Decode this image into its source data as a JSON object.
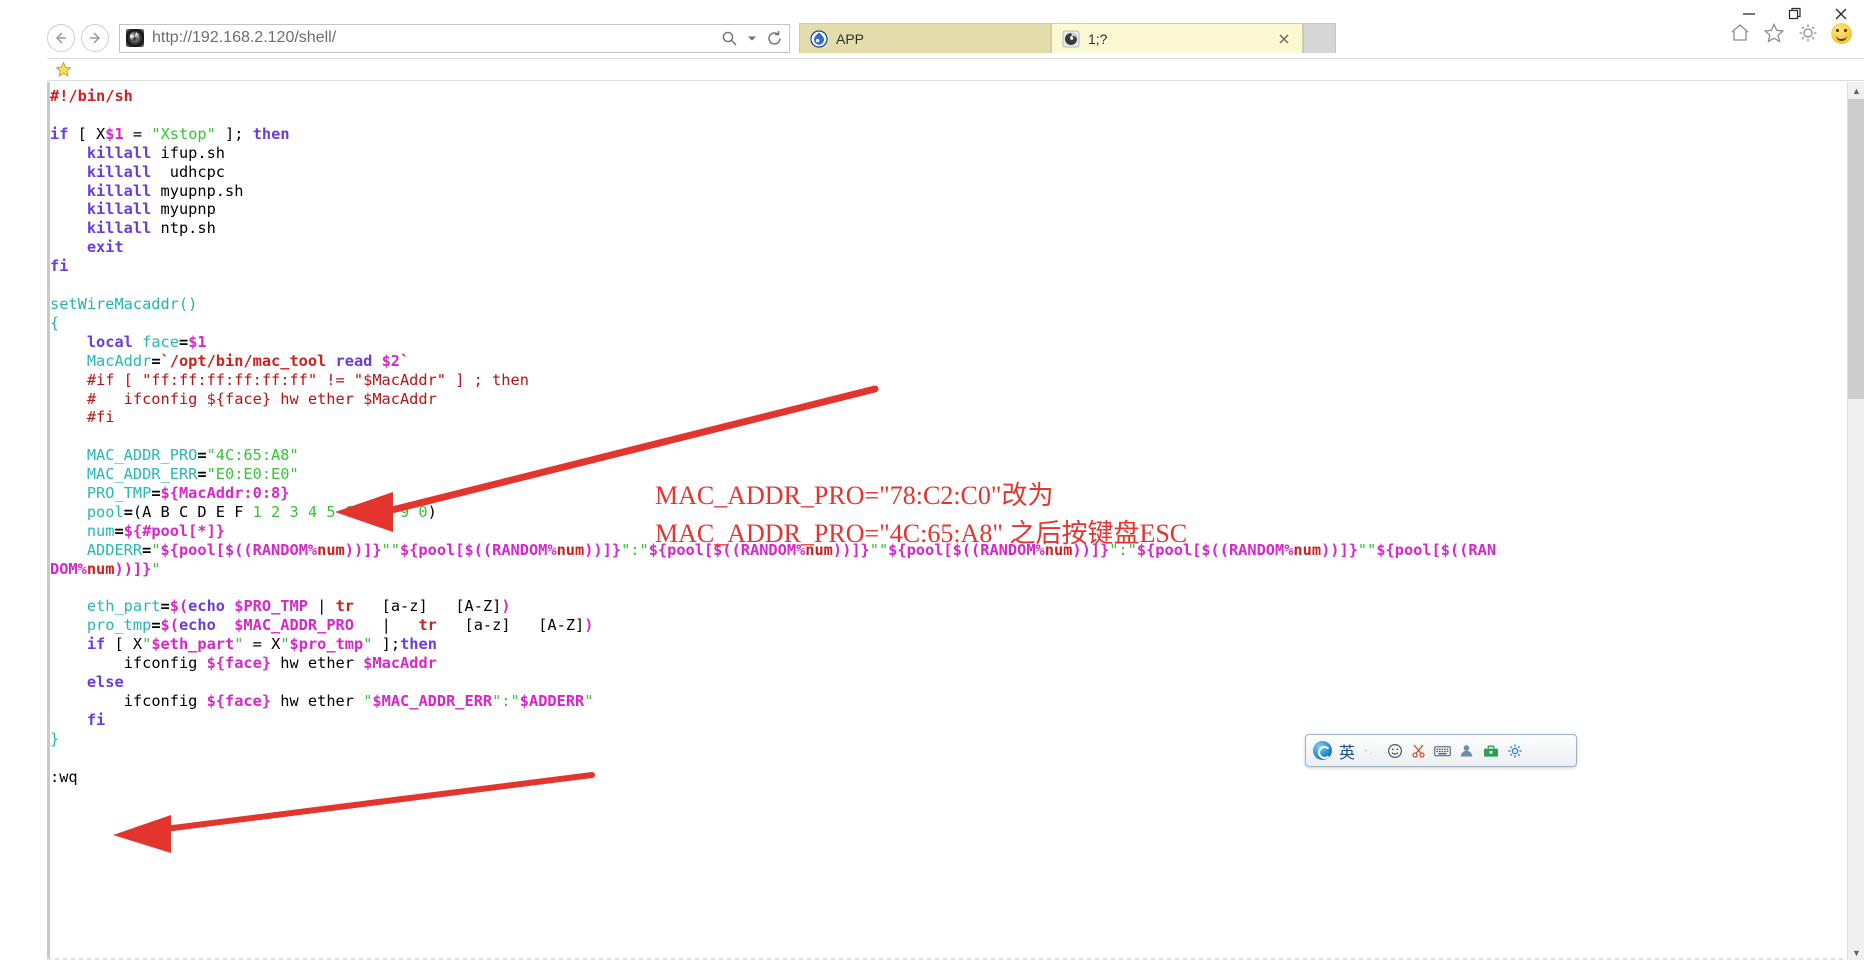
{
  "window": {
    "minimize_label": "Minimize",
    "restore_label": "Restore",
    "close_label": "Close"
  },
  "browser": {
    "back_label": "Back",
    "forward_label": "Forward",
    "url": "http://192.168.2.120/shell/",
    "search_label": "Search",
    "refresh_label": "Refresh",
    "home_label": "Home",
    "favorites_label": "Favorites",
    "tools_label": "Tools",
    "smiley_label": "Feedback",
    "tabs": [
      {
        "label": "APP",
        "active": false,
        "closable": false
      },
      {
        "label": "1;?",
        "active": true,
        "closable": true
      }
    ],
    "new_tab_label": "New tab"
  },
  "code": {
    "language": "sh",
    "lines": [
      "#!/bin/sh",
      "",
      "if [ X$1 = \"Xstop\" ]; then",
      "    killall ifup.sh",
      "    killall  udhcpc",
      "    killall myupnp.sh",
      "    killall myupnp",
      "    killall ntp.sh",
      "    exit",
      "fi",
      "",
      "setWireMacaddr()",
      "{",
      "    local face=$1",
      "    MacAddr=`/opt/bin/mac_tool read $2`",
      "    #if [ \"ff:ff:ff:ff:ff:ff\" != \"$MacAddr\" ] ; then",
      "    #   ifconfig ${face} hw ether $MacAddr",
      "    #fi",
      "",
      "    MAC_ADDR_PRO=\"4C:65:A8\"",
      "    MAC_ADDR_ERR=\"E0:E0:E0\"",
      "    PRO_TMP=${MacAddr:0:8}",
      "    pool=(A B C D E F 1 2 3 4 5 6 7 8 9 0)",
      "    num=${#pool[*]}",
      "    ADDERR=\"${pool[$((RANDOM%num))]}\"\"${pool[$((RANDOM%num))]}\":\"${pool[$((RANDOM%num))]}\"\"${pool[$((RANDOM%num))]}\":\"${pool[$((RANDOM%num))]}\"\"${pool[$((RANDOM%num))]}\"",
      "",
      "    eth_part=$(echo $PRO_TMP | tr   [a-z]   [A-Z])",
      "    pro_tmp=$(echo  $MAC_ADDR_PRO   |   tr   [a-z]   [A-Z])",
      "    if [ X\"$eth_part\" = X\"$pro_tmp\" ];then",
      "        ifconfig ${face} hw ether $MacAddr",
      "    else",
      "        ifconfig ${face} hw ether \"$MAC_ADDR_ERR\":\"$ADDERR\"",
      "    fi",
      "}",
      "",
      ":wq"
    ],
    "mac_addr_pro_value": "4C:65:A8",
    "mac_addr_err_value": "E0:E0:E0",
    "vim_command": ":wq"
  },
  "annotations": {
    "line1": "MAC_ADDR_PRO=\"78:C2:C0\"改为",
    "line2": "MAC_ADDR_PRO=\"4C:65:A8\" 之后按键盘ESC",
    "arrow_color": "#e3352e"
  },
  "ime": {
    "logo_label": "sogou-pinyin-logo",
    "mode": "英",
    "items": [
      "input-mode-icon",
      "emoji-icon",
      "scissors-icon",
      "keyboard-icon",
      "user-icon",
      "toolbox-icon",
      "settings-icon"
    ]
  },
  "colors": {
    "tab_active": "#fbf8d4",
    "tab_inactive": "#e3dcab",
    "annotation_red": "#e3352e",
    "comment_red": "#b81414",
    "string_green": "#36c436",
    "variable_teal": "#23b3b3",
    "keyword_purple": "#6a3ce0",
    "dollar_magenta": "#d726c9"
  },
  "scrollbar": {
    "up_arrow": "▲",
    "down_arrow": "▼"
  }
}
